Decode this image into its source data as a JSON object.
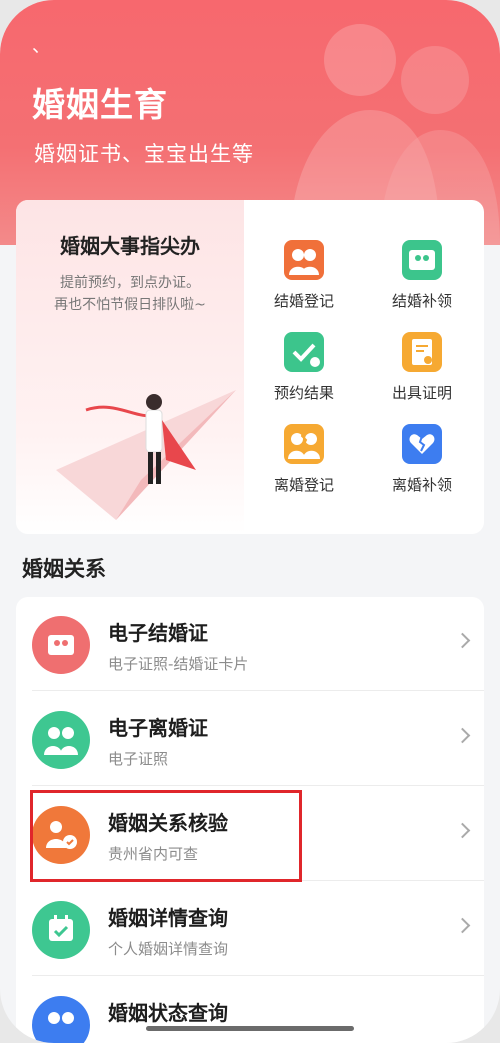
{
  "hero": {
    "status_mark": "、",
    "title": "婚姻生育",
    "subtitle": "婚姻证书、宝宝出生等"
  },
  "promo": {
    "title": "婚姻大事指尖办",
    "line1": "提前预约，到点办证。",
    "line2": "再也不怕节假日排队啦~"
  },
  "services": [
    {
      "label": "结婚登记",
      "icon": "couple-icon",
      "color": "#f0703a"
    },
    {
      "label": "结婚补领",
      "icon": "id-card-icon",
      "color": "#3cc58c"
    },
    {
      "label": "预约结果",
      "icon": "check-heart-icon",
      "color": "#3cc58c"
    },
    {
      "label": "出具证明",
      "icon": "certificate-icon",
      "color": "#f6a932"
    },
    {
      "label": "离婚登记",
      "icon": "broken-couple-icon",
      "color": "#f6a932"
    },
    {
      "label": "离婚补领",
      "icon": "broken-heart-card-icon",
      "color": "#3d7df0"
    }
  ],
  "section": {
    "title": "婚姻关系"
  },
  "rows": [
    {
      "title": "电子结婚证",
      "subtitle": "电子证照-结婚证卡片",
      "icon": "marriage-card-icon",
      "color": "#ef6f70"
    },
    {
      "title": "电子离婚证",
      "subtitle": "电子证照",
      "icon": "divorce-couple-icon",
      "color": "#3ec791"
    },
    {
      "title": "婚姻关系核验",
      "subtitle": "贵州省内可查",
      "icon": "verify-couple-icon",
      "color": "#f0783a"
    },
    {
      "title": "婚姻详情查询",
      "subtitle": "个人婚姻详情查询",
      "icon": "calendar-check-icon",
      "color": "#3ec791"
    },
    {
      "title": "婚姻状态查询",
      "subtitle": "",
      "icon": "status-couple-icon",
      "color": "#3d7df0"
    }
  ]
}
